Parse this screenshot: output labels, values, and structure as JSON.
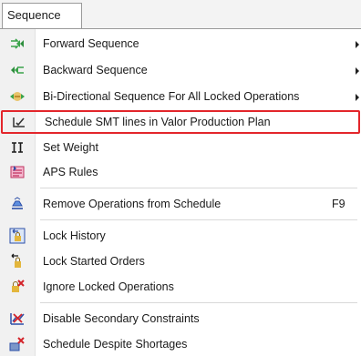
{
  "menubar": {
    "active_menu": "Sequence"
  },
  "menu": {
    "items": [
      {
        "label": "Forward Sequence",
        "icon": "forward-arrows-icon",
        "submenu": true
      },
      {
        "label": "Backward Sequence",
        "icon": "backward-arrows-icon",
        "submenu": true
      },
      {
        "label": "Bi-Directional Sequence For All Locked Operations",
        "icon": "bidirectional-arrows-icon",
        "submenu": true
      },
      {
        "label": "Schedule SMT lines in Valor Production Plan",
        "icon": "schedule-check-icon",
        "highlighted": true
      },
      {
        "label": "Set Weight",
        "icon": "weight-bars-icon"
      },
      {
        "label": "APS Rules",
        "icon": "rules-icon"
      },
      {
        "label": "Remove Operations from Schedule",
        "icon": "remove-operations-icon",
        "shortcut": "F9"
      },
      {
        "label": "Lock History",
        "icon": "lock-history-icon"
      },
      {
        "label": "Lock Started Orders",
        "icon": "lock-started-icon"
      },
      {
        "label": "Ignore Locked Operations",
        "icon": "ignore-locked-icon"
      },
      {
        "label": "Disable Secondary Constraints",
        "icon": "disable-constraints-icon"
      },
      {
        "label": "Schedule Despite Shortages",
        "icon": "schedule-shortages-icon"
      }
    ]
  },
  "colors": {
    "highlight_border": "#e3262b",
    "gutter": "#f1f1f1"
  }
}
